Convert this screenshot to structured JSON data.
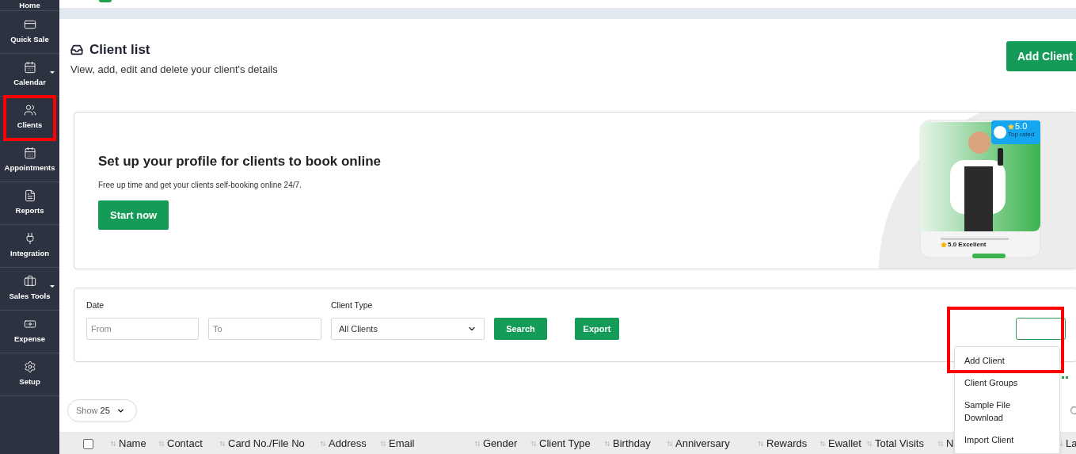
{
  "sidebar": {
    "items": [
      {
        "label": "Home",
        "has_submenu": false,
        "highlighted": false
      },
      {
        "label": "Quick Sale",
        "has_submenu": false,
        "highlighted": false
      },
      {
        "label": "Calendar",
        "has_submenu": true,
        "highlighted": false
      },
      {
        "label": "Clients",
        "has_submenu": false,
        "highlighted": true
      },
      {
        "label": "Appointments",
        "has_submenu": false,
        "highlighted": false
      },
      {
        "label": "Reports",
        "has_submenu": false,
        "highlighted": false
      },
      {
        "label": "Integration",
        "has_submenu": false,
        "highlighted": false
      },
      {
        "label": "Sales Tools",
        "has_submenu": true,
        "highlighted": false
      },
      {
        "label": "Expense",
        "has_submenu": false,
        "highlighted": false
      },
      {
        "label": "Setup",
        "has_submenu": false,
        "highlighted": false
      }
    ]
  },
  "header": {
    "title": "Client list",
    "subtitle": "View, add, edit and delete your client's details",
    "add_button": "Add Client"
  },
  "banner": {
    "title": "Set up your profile for clients to book online",
    "text": "Free up time and get your clients self-booking online 24/7.",
    "button": "Start now",
    "rating": "5.0",
    "rating_caption": "Top rated",
    "review": "5.0 Excellent"
  },
  "filters": {
    "date_label": "Date",
    "from_placeholder": "From",
    "to_placeholder": "To",
    "type_label": "Client Type",
    "type_value": "All Clients",
    "search_button": "Search",
    "export_button": "Export"
  },
  "menu": {
    "items": [
      {
        "label": "Add Client",
        "highlighted": true
      },
      {
        "label": "Client Groups",
        "highlighted": false
      },
      {
        "label": "Sample File Download",
        "highlighted": false
      },
      {
        "label": "Import Client",
        "highlighted": false
      }
    ]
  },
  "show": {
    "label": "Show",
    "value": "25"
  },
  "table": {
    "select_all": {
      "checked": false
    },
    "columns": [
      "Name",
      "Contact",
      "Card No./File No",
      "Address",
      "Email",
      "Gender",
      "Client Type",
      "Birthday",
      "Anniversary",
      "Rewards",
      "Ewallet",
      "Total Visits",
      "N",
      "La"
    ]
  }
}
